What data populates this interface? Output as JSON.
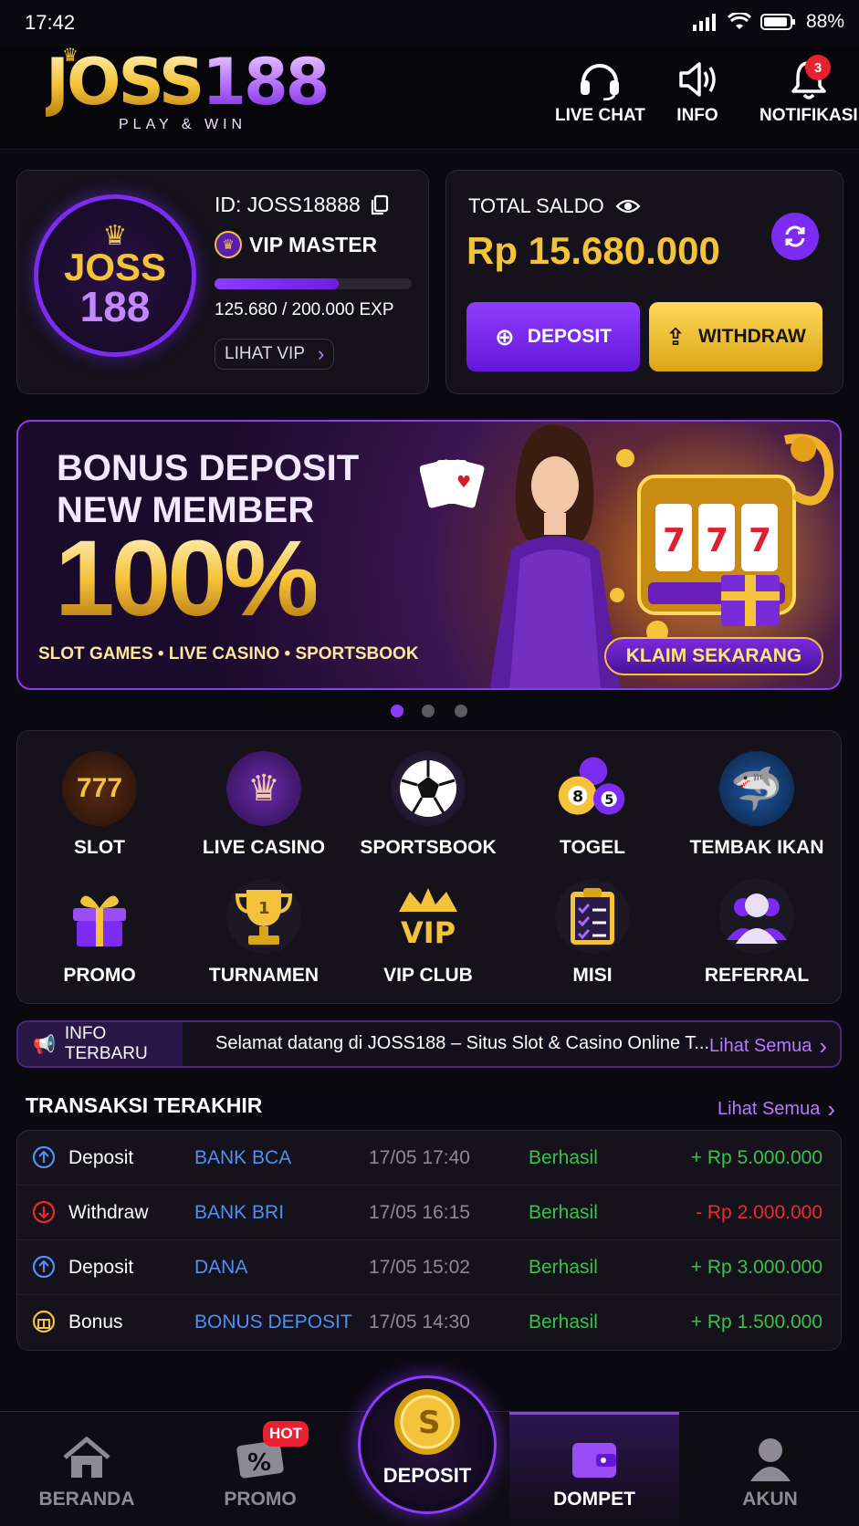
{
  "status_bar": {
    "time": "17:42",
    "battery": "88%"
  },
  "header": {
    "logo_main": "JOSS",
    "logo_num": "188",
    "logo_tagline": "PLAY & WIN",
    "actions": [
      {
        "label": "LIVE CHAT",
        "icon": "headset-icon"
      },
      {
        "label": "INFO",
        "icon": "speaker-icon"
      },
      {
        "label": "NOTIFIKASI",
        "icon": "bell-icon",
        "badge": "3"
      }
    ]
  },
  "profile": {
    "avatar_top": "JOSS",
    "avatar_bottom": "188",
    "user_id": "ID: JOSS18888",
    "vip_level": "VIP MASTER",
    "exp_text": "125.680 / 200.000 EXP",
    "exp_progress": 0.628,
    "vip_link": "LIHAT VIP"
  },
  "balance": {
    "label": "TOTAL SALDO",
    "amount": "Rp 15.680.000",
    "deposit_label": "DEPOSIT",
    "withdraw_label": "WITHDRAW"
  },
  "banner": {
    "line1": "BONUS DEPOSIT",
    "line2": "NEW MEMBER",
    "percent": "100%",
    "subtitle": "SLOT GAMES • LIVE CASINO • SPORTSBOOK",
    "cta": "KLAIM SEKARANG",
    "dots": 3,
    "active_dot": 0
  },
  "games": [
    {
      "label": "SLOT",
      "icon": "slot-machine-icon"
    },
    {
      "label": "LIVE CASINO",
      "icon": "live-casino-icon"
    },
    {
      "label": "SPORTSBOOK",
      "icon": "soccer-ball-icon"
    },
    {
      "label": "TOGEL",
      "icon": "lottery-balls-icon"
    },
    {
      "label": "TEMBAK IKAN",
      "icon": "fish-shooter-icon"
    },
    {
      "label": "PROMO",
      "icon": "gift-icon"
    },
    {
      "label": "TURNAMEN",
      "icon": "trophy-icon"
    },
    {
      "label": "VIP CLUB",
      "icon": "vip-crown-icon"
    },
    {
      "label": "MISI",
      "icon": "checklist-icon"
    },
    {
      "label": "REFERRAL",
      "icon": "users-icon"
    }
  ],
  "info": {
    "label": "INFO TERBARU",
    "text": "Selamat datang di JOSS188 – Situs Slot & Casino Online T...",
    "link": "Lihat Semua"
  },
  "transactions": {
    "title": "TRANSAKSI TERAKHIR",
    "link": "Lihat Semua",
    "rows": [
      {
        "type": "Deposit",
        "method": "BANK BCA",
        "time": "17/05 17:40",
        "status": "Berhasil",
        "amount": "+ Rp 5.000.000",
        "icon": "deposit-icon",
        "color": "#38c24a"
      },
      {
        "type": "Withdraw",
        "method": "BANK BRI",
        "time": "17/05 16:15",
        "status": "Berhasil",
        "amount": "- Rp 2.000.000",
        "icon": "withdraw-icon",
        "color": "#ee2b2b"
      },
      {
        "type": "Deposit",
        "method": "DANA",
        "time": "17/05 15:02",
        "status": "Berhasil",
        "amount": "+ Rp 3.000.000",
        "icon": "deposit-icon",
        "color": "#38c24a"
      },
      {
        "type": "Bonus",
        "method": "BONUS DEPOSIT",
        "time": "17/05 14:30",
        "status": "Berhasil",
        "amount": "+ Rp 1.500.000",
        "icon": "bonus-icon",
        "color": "#38c24a"
      }
    ]
  },
  "bottom_nav": [
    {
      "label": "BERANDA",
      "icon": "home-icon"
    },
    {
      "label": "PROMO",
      "icon": "promo-ticket-icon",
      "badge": "HOT"
    },
    {
      "label": "DEPOSIT",
      "icon": "coin-icon"
    },
    {
      "label": "DOMPET",
      "icon": "wallet-icon",
      "active": true
    },
    {
      "label": "AKUN",
      "icon": "user-icon"
    }
  ],
  "colors": {
    "accent": "#7b2cf0",
    "gold": "#f3c33b",
    "positive": "#38c24a",
    "negative": "#ee2b2b",
    "link": "#b77bff",
    "method": "#4f8ff7"
  }
}
